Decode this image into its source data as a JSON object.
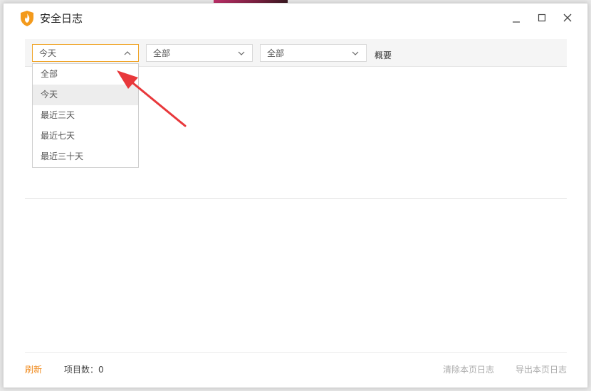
{
  "window": {
    "title": "安全日志",
    "controls": {
      "minimize": "minimize-icon",
      "maximize": "maximize-icon",
      "close": "close-icon"
    }
  },
  "toolbar": {
    "date_filter": "今天",
    "type_filter": "全部",
    "level_filter": "全部",
    "summary_label": "概要"
  },
  "date_dropdown": {
    "options": [
      "全部",
      "今天",
      "最近三天",
      "最近七天",
      "最近三十天"
    ],
    "highlighted": "今天"
  },
  "footer": {
    "refresh": "刷新",
    "item_count": "项目数：0",
    "clear_page": "清除本页日志",
    "export_page": "导出本页日志"
  },
  "colors": {
    "accent": "#f08a1d",
    "annotation_arrow": "#e8383b",
    "logo": "#f39a1c"
  }
}
